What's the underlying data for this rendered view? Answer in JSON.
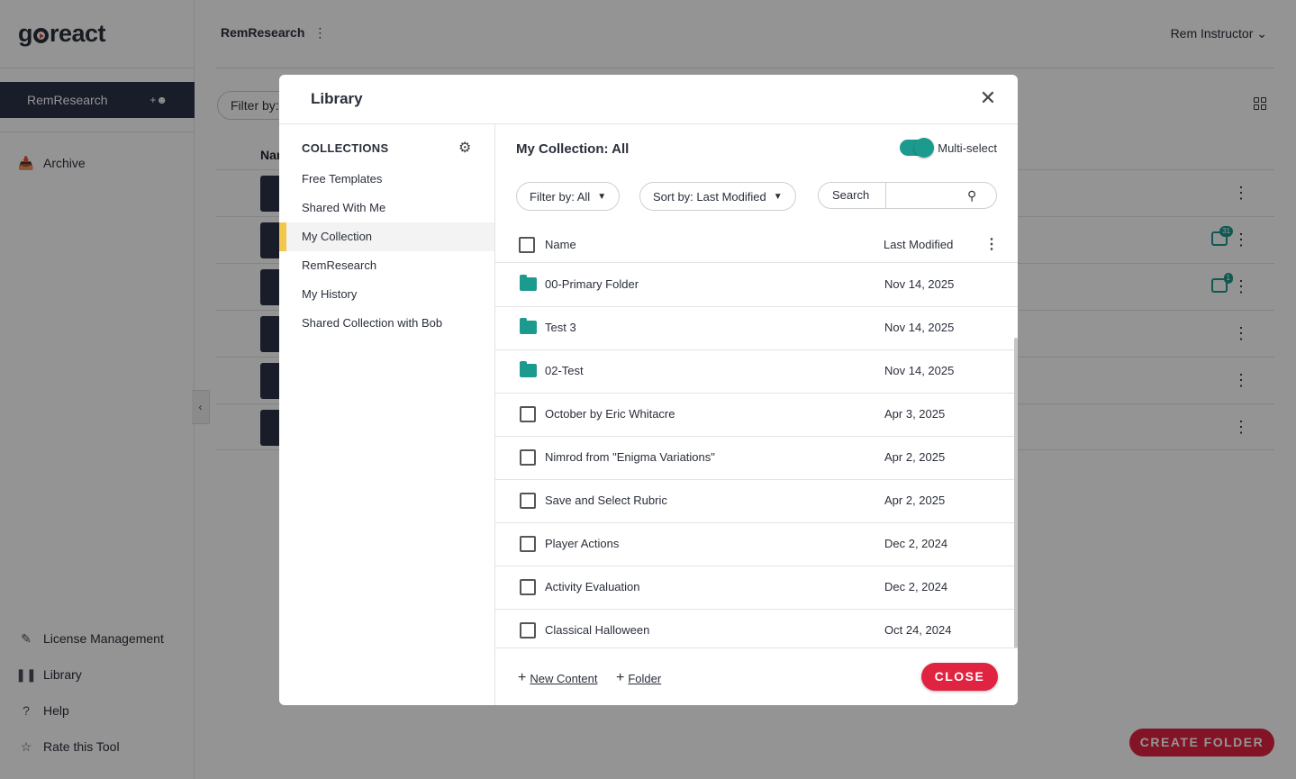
{
  "app": {
    "logo": "goreact",
    "course_name": "RemResearch",
    "topbar_title": "RemResearch",
    "user_name": "Rem Instructor",
    "sidebar": {
      "archive": "Archive",
      "bottom_links": [
        {
          "label": "License Management",
          "icon": "license-icon"
        },
        {
          "label": "Library",
          "icon": "library-icon"
        },
        {
          "label": "Help",
          "icon": "help-icon"
        },
        {
          "label": "Rate this Tool",
          "icon": "star-icon"
        }
      ]
    },
    "filter_label": "Filter by:",
    "table_header_name": "Nar",
    "comment_badges": [
      "31",
      "1"
    ],
    "create_folder": "CREATE FOLDER"
  },
  "modal": {
    "title": "Library",
    "collections_heading": "COLLECTIONS",
    "collections": [
      {
        "label": "Free Templates",
        "active": false
      },
      {
        "label": "Shared With Me",
        "active": false
      },
      {
        "label": "My Collection",
        "active": true
      },
      {
        "label": "RemResearch",
        "active": false
      },
      {
        "label": "My History",
        "active": false
      },
      {
        "label": "Shared Collection with Bob",
        "active": false
      }
    ],
    "content_title": "My Collection: All",
    "multiselect_label": "Multi-select",
    "multiselect_on": true,
    "filter": "Filter by: All",
    "sort": "Sort by: Last Modified",
    "search_label": "Search",
    "search_value": "",
    "columns": {
      "name": "Name",
      "modified": "Last Modified"
    },
    "items": [
      {
        "type": "folder",
        "name": "00-Primary Folder",
        "modified": "Nov 14, 2025"
      },
      {
        "type": "folder",
        "name": "Test 3",
        "modified": "Nov 14, 2025"
      },
      {
        "type": "folder",
        "name": "02-Test",
        "modified": "Nov 14, 2025"
      },
      {
        "type": "item",
        "name": "October by Eric Whitacre",
        "modified": "Apr 3, 2025"
      },
      {
        "type": "item",
        "name": "Nimrod from \"Enigma Variations\"",
        "modified": "Apr 2, 2025"
      },
      {
        "type": "item",
        "name": "Save and Select Rubric",
        "modified": "Apr 2, 2025"
      },
      {
        "type": "item",
        "name": "Player Actions",
        "modified": "Dec 2, 2024"
      },
      {
        "type": "item",
        "name": "Activity Evaluation",
        "modified": "Dec 2, 2024"
      },
      {
        "type": "item",
        "name": "Classical Halloween",
        "modified": "Oct 24, 2024"
      }
    ],
    "footer": {
      "new_content": "New Content",
      "folder": "Folder",
      "close": "CLOSE"
    },
    "colors": {
      "accent": "#1d9a8e",
      "danger": "#e02341",
      "active_marker": "#f3c74b"
    }
  }
}
